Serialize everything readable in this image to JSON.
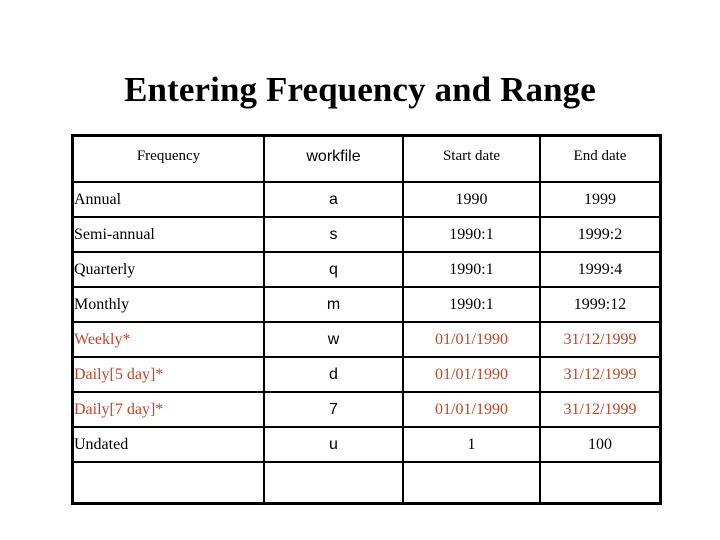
{
  "slide": {
    "title": "Entering Frequency and Range",
    "background_color": "#FFFFFF",
    "text_color": "#000000",
    "highlight_color": "#C0462A"
  },
  "table": {
    "columns": [
      {
        "key": "frequency",
        "label": "Frequency",
        "align": "center",
        "font": "serif"
      },
      {
        "key": "workfile",
        "label": "workfile",
        "align": "center",
        "font": "sans-serif"
      },
      {
        "key": "start_date",
        "label": "Start date",
        "align": "center",
        "font": "serif"
      },
      {
        "key": "end_date",
        "label": "End date",
        "align": "center",
        "font": "serif"
      }
    ],
    "rows": [
      {
        "frequency": "Annual",
        "workfile": "a",
        "start_date": "1990",
        "end_date": "1999",
        "highlight": false
      },
      {
        "frequency": "Semi-annual",
        "workfile": "s",
        "start_date": "1990:1",
        "end_date": "1999:2",
        "highlight": false
      },
      {
        "frequency": "Quarterly",
        "workfile": "q",
        "start_date": "1990:1",
        "end_date": "1999:4",
        "highlight": false
      },
      {
        "frequency": "Monthly",
        "workfile": "m",
        "start_date": "1990:1",
        "end_date": "1999:12",
        "highlight": false
      },
      {
        "frequency": "Weekly*",
        "workfile": "w",
        "start_date": "01/01/1990",
        "end_date": "31/12/1999",
        "highlight": true
      },
      {
        "frequency": "Daily[5 day]*",
        "workfile": "d",
        "start_date": "01/01/1990",
        "end_date": "31/12/1999",
        "highlight": true
      },
      {
        "frequency": "Daily[7 day]*",
        "workfile": "7",
        "start_date": "01/01/1990",
        "end_date": "31/12/1999",
        "highlight": true
      },
      {
        "frequency": "Undated",
        "workfile": "u",
        "start_date": "1",
        "end_date": "100",
        "highlight": false
      },
      {
        "frequency": "",
        "workfile": "",
        "start_date": "",
        "end_date": "",
        "highlight": false
      }
    ]
  }
}
